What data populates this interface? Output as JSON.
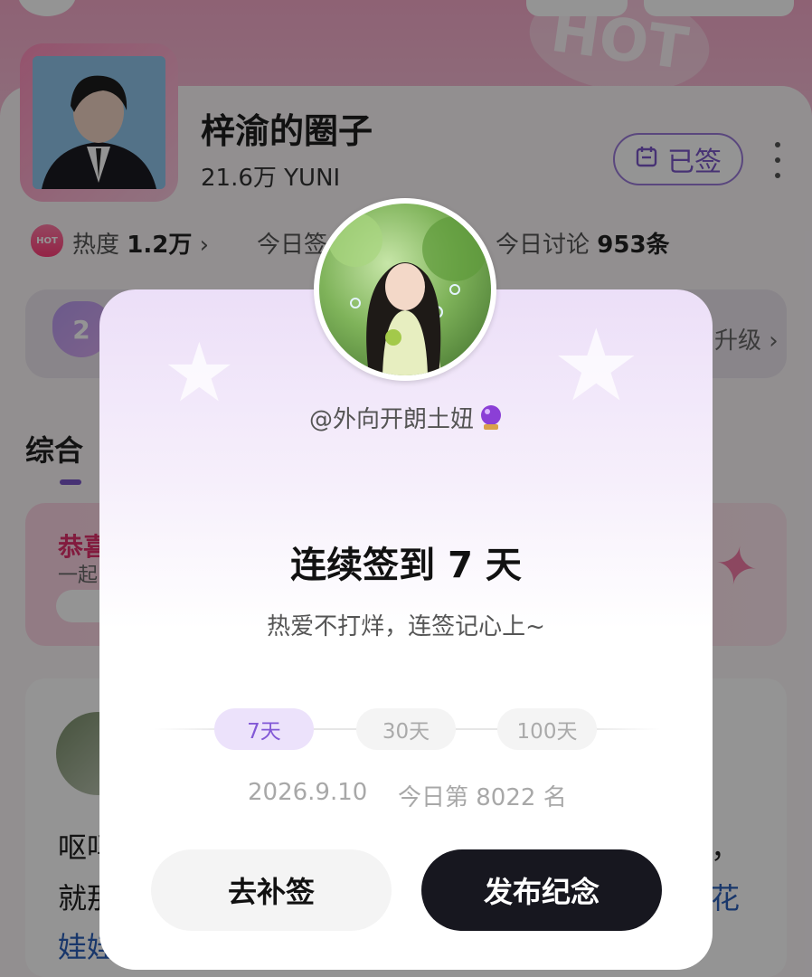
{
  "header": {
    "hot_watermark": "HOT"
  },
  "circle": {
    "name": "梓渝的圈子",
    "followers": "21.6万 YUNI",
    "signed_label": "已签"
  },
  "stats": {
    "heat_icon_text": "HOT",
    "heat_label": "热度",
    "heat_value": "1.2万",
    "heat_chevron": "›",
    "today_sign_label": "今日签",
    "discuss_label": "今日讨论",
    "discuss_value": "953条"
  },
  "level": {
    "badge": "2",
    "right_text": "升级 ›"
  },
  "tabs": {
    "first": "综合"
  },
  "promo": {
    "title": "恭喜",
    "subtitle": "一起"
  },
  "post": {
    "line1": "呕吗",
    "line2": "就那",
    "line3": "娃娃",
    "right1": "，",
    "right2": "花"
  },
  "modal": {
    "username": "@外向开朗土妞",
    "title": "连续签到 7 天",
    "subtitle": "热爱不打烊，连签记心上~",
    "milestones": [
      "7天",
      "30天",
      "100天"
    ],
    "active_milestone": "7天",
    "date": "2026.9.10",
    "rank": "今日第 8022 名",
    "makeup_button": "去补签",
    "publish_button": "发布纪念"
  },
  "colors": {
    "accent_purple": "#8258d6",
    "dark_button": "#17171f",
    "pink": "#e0306c"
  }
}
